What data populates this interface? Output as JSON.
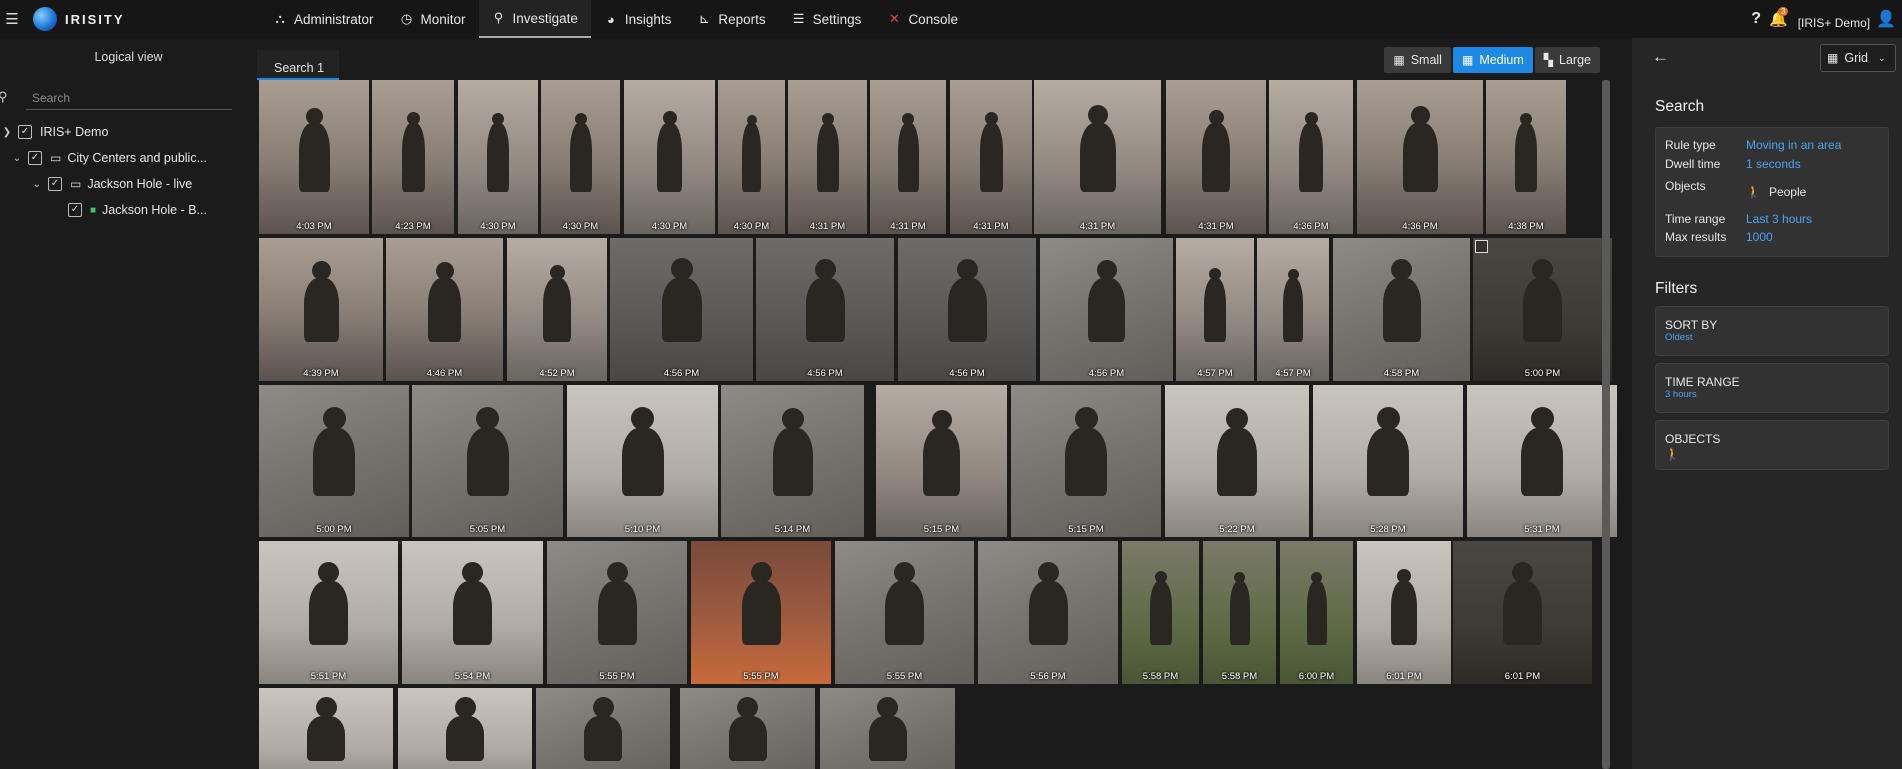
{
  "app": {
    "logo_text": "IRISITY",
    "nav": [
      {
        "label": "Administrator",
        "icon": "sitemap-icon",
        "glyph": "⛬"
      },
      {
        "label": "Monitor",
        "icon": "clock-icon",
        "glyph": "◷"
      },
      {
        "label": "Investigate",
        "icon": "search-icon",
        "glyph": "⚲"
      },
      {
        "label": "Insights",
        "icon": "pie-chart-icon",
        "glyph": "◕"
      },
      {
        "label": "Reports",
        "icon": "chart-icon",
        "glyph": "⊾"
      },
      {
        "label": "Settings",
        "icon": "sliders-icon",
        "glyph": "☰"
      },
      {
        "label": "Console",
        "icon": "tools-icon",
        "glyph": "✕"
      }
    ],
    "notifications_count": "3",
    "user_label": "[IRIS+ Demo]"
  },
  "sidebar": {
    "title": "Logical view",
    "search_placeholder": "Search",
    "tree": [
      {
        "label": "IRIS+ Demo"
      },
      {
        "label": "City Centers and public..."
      },
      {
        "label": "Jackson Hole - live"
      },
      {
        "label": "Jackson Hole - B..."
      }
    ]
  },
  "main": {
    "tab_label": "Search 1",
    "sizes": [
      {
        "label": "Small",
        "active": false
      },
      {
        "label": "Medium",
        "active": true
      },
      {
        "label": "Large",
        "active": false
      }
    ],
    "thumbnails": [
      {
        "time": "4:03 PM"
      },
      {
        "time": "4:23 PM"
      },
      {
        "time": "4:30 PM"
      },
      {
        "time": "4:30 PM"
      },
      {
        "time": "4:30 PM"
      },
      {
        "time": "4:30 PM"
      },
      {
        "time": "4:31 PM"
      },
      {
        "time": "4:31 PM"
      },
      {
        "time": "4:31 PM"
      },
      {
        "time": "4:31 PM"
      },
      {
        "time": "4:31 PM"
      },
      {
        "time": "4:36 PM"
      },
      {
        "time": "4:36 PM"
      },
      {
        "time": "4:38 PM"
      },
      {
        "time": "4:39 PM"
      },
      {
        "time": "4:46 PM"
      },
      {
        "time": "4:52 PM"
      },
      {
        "time": "4:56 PM"
      },
      {
        "time": "4:56 PM"
      },
      {
        "time": "4:56 PM"
      },
      {
        "time": "4:56 PM"
      },
      {
        "time": "4:57 PM"
      },
      {
        "time": "4:57 PM"
      },
      {
        "time": "4:58 PM"
      },
      {
        "time": "5:00 PM"
      },
      {
        "time": "5:00 PM"
      },
      {
        "time": "5:05 PM"
      },
      {
        "time": "5:10 PM"
      },
      {
        "time": "5:14 PM"
      },
      {
        "time": "5:15 PM"
      },
      {
        "time": "5:15 PM"
      },
      {
        "time": "5:22 PM"
      },
      {
        "time": "5:28 PM"
      },
      {
        "time": "5:31 PM"
      },
      {
        "time": "5:51 PM"
      },
      {
        "time": "5:54 PM"
      },
      {
        "time": "5:55 PM"
      },
      {
        "time": "5:55 PM"
      },
      {
        "time": "5:55 PM"
      },
      {
        "time": "5:56 PM"
      },
      {
        "time": "5:58 PM"
      },
      {
        "time": "5:58 PM"
      },
      {
        "time": "6:00 PM"
      },
      {
        "time": "6:01 PM"
      },
      {
        "time": "6:01 PM"
      },
      {
        "time": ""
      },
      {
        "time": ""
      },
      {
        "time": ""
      },
      {
        "time": ""
      },
      {
        "time": ""
      }
    ]
  },
  "right_panel": {
    "view_label": "Grid",
    "search_title": "Search",
    "rule_type_key": "Rule type",
    "rule_type_val": "Moving in an area",
    "dwell_key": "Dwell time",
    "dwell_val": "1 seconds",
    "objects_key": "Objects",
    "objects_val": "People",
    "time_range_key": "Time range",
    "time_range_val": "Last 3 hours",
    "max_results_key": "Max results",
    "max_results_val": "1000",
    "filters_title": "Filters",
    "sort_by_label": "SORT BY",
    "sort_by_val": "Oldest",
    "time_range_label": "TIME RANGE",
    "time_range_filter_val": "3 hours",
    "objects_label": "OBJECTS"
  },
  "colors": {
    "accent": "#1e88e5",
    "link": "#4aa3f5",
    "console_icon": "#e0433a",
    "camera_icon": "#39c96b",
    "badge": "#e07020"
  }
}
